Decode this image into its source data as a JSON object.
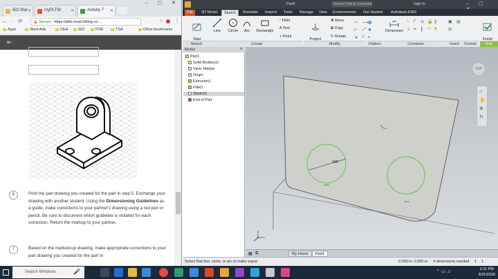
{
  "browser": {
    "tabs": [
      {
        "label": "IED Mar",
        "color": "#e7b93b"
      },
      {
        "label": "myPLTW",
        "color": "#e0552b"
      },
      {
        "label": "Activity 7",
        "color": "#3a9b3e"
      }
    ],
    "address": "https://pltw.read.inkling.co...",
    "secure_label": "Secure",
    "bookmarks": [
      "Apps",
      "West Ada",
      "CEA",
      "IED",
      "POE",
      "TSA"
    ],
    "bookmarks_other": "Other bookmarks",
    "steps": [
      {
        "number": "6",
        "text_before": "Print the part drawing you created for the part in step 5. Exchange your drawing with another student. Using the ",
        "text_bold": "Dimensioning Guidelines",
        "text_after": " as a guide, make corrections to your partner's drawing using a red pen or pencil. Be sure to document which guideline is violated for each correction. Return the markup to your partner."
      },
      {
        "number": "7",
        "text_before": "Based on the marked-up drawing, make appropriate corrections to your part drawing you created for the part in",
        "text_bold": "",
        "text_after": ""
      }
    ]
  },
  "inventor": {
    "search_placeholder": "Search Help & Commands...",
    "title": "Part1",
    "sign_in": "Sign In",
    "menu": [
      "File",
      "3D Model",
      "Sketch",
      "Annotate",
      "Inspect",
      "Tools",
      "Manage",
      "View",
      "Environments",
      "Get Started",
      "Autodesk A360"
    ],
    "active_menu": "Sketch",
    "ribbon": {
      "start_sketch": "Start\n2D Sketch",
      "line": "Line",
      "circle": "Circle",
      "arc": "Arc",
      "rectangle": "Rectangle",
      "fillet": "Fillet",
      "text": "Text",
      "point": "Point",
      "project_geometry": "Project\nGeometry",
      "move": "Move",
      "copy": "Copy",
      "rotate": "Rotate",
      "dimension": "Dimension",
      "finish_sketch": "Finish\nSketch",
      "groups": [
        "Sketch",
        "Create",
        "Modify",
        "Pattern",
        "Constrain",
        "Insert",
        "Format",
        "Exit"
      ]
    },
    "browser_panel": {
      "header": "Model",
      "items": [
        "Part1",
        "Solid Bodies(1)",
        "View: Master",
        "Origin",
        "Extrusion1",
        "Fillet1",
        "Sketch2",
        "End of Part"
      ]
    },
    "viewcube_label": "TOP",
    "dimension_label": "100",
    "doc_tabs": [
      "My Home",
      "Part1"
    ],
    "status_text": "Select first line, circle, or arc to make equal",
    "status_coords": "0.000 in, 0.000 in",
    "status_dims": "4 dimensions needed",
    "status_page": "1",
    "status_page2": "1"
  },
  "taskbar": {
    "search_placeholder": "Search Windows",
    "time": "2:11 PM",
    "date": "3/21/2018"
  }
}
